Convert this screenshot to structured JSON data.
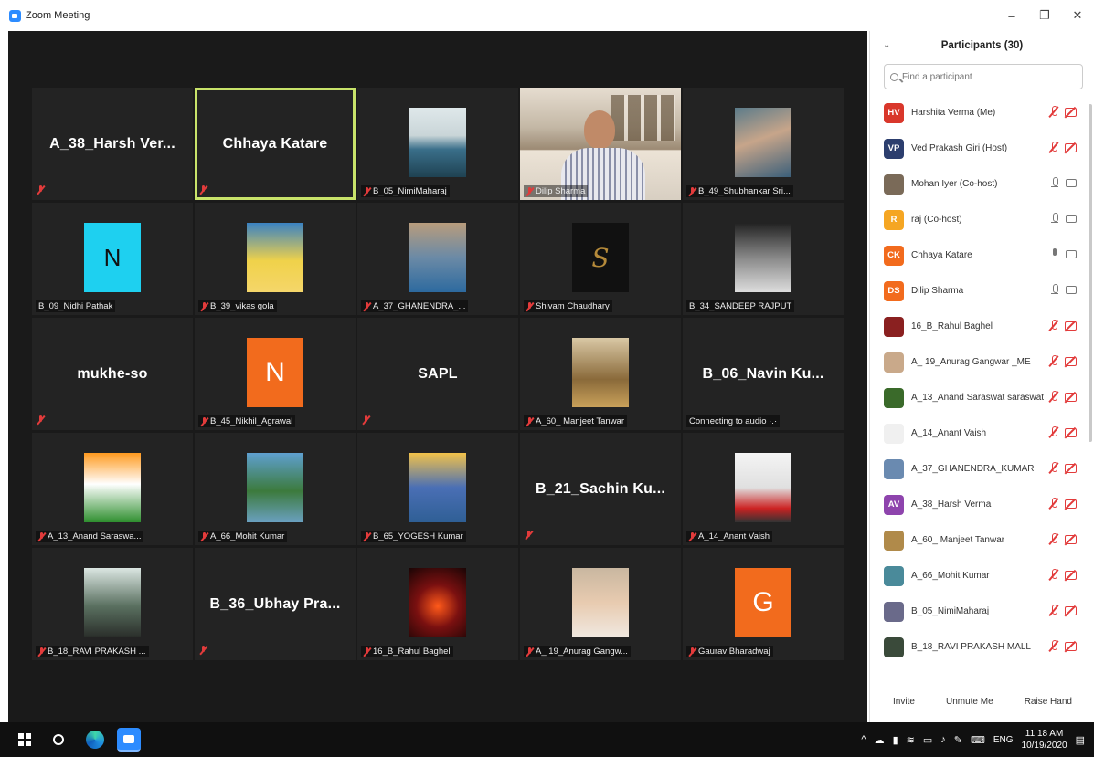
{
  "window": {
    "title": "Zoom Meeting",
    "minimize": "–",
    "restore": "❐",
    "close": "✕"
  },
  "tiles": [
    {
      "type": "text",
      "name": "A_38_Harsh Ver...",
      "label": ""
    },
    {
      "type": "text",
      "name": "Chhaya Katare",
      "label": "",
      "active": true
    },
    {
      "type": "photo",
      "photo": "ph1",
      "label": "B_05_NimiMaharaj"
    },
    {
      "type": "video",
      "label": "Dilip Sharma"
    },
    {
      "type": "photo",
      "photo": "ph2",
      "label": "B_49_Shubhankar Sri..."
    },
    {
      "type": "letter",
      "letter": "N",
      "color": "av-cyan",
      "label": "B_09_Nidhi Pathak",
      "nomute": true
    },
    {
      "type": "photo",
      "photo": "ph3",
      "label": "B_39_vikas gola"
    },
    {
      "type": "photo",
      "photo": "ph4",
      "label": "A_37_GHANENDRA_..."
    },
    {
      "type": "glyph",
      "glyph": "S",
      "label": "Shivam Chaudhary"
    },
    {
      "type": "photo",
      "photo": "ph6",
      "label": "B_34_SANDEEP RAJPUT",
      "nomute": true
    },
    {
      "type": "text",
      "name": "mukhe-so",
      "label": ""
    },
    {
      "type": "letter",
      "letter": "N",
      "color": "av-orange",
      "label": "B_45_Nikhil_Agrawal"
    },
    {
      "type": "text",
      "name": "SAPL",
      "label": ""
    },
    {
      "type": "photo",
      "photo": "ph7",
      "label": "A_60_ Manjeet Tanwar"
    },
    {
      "type": "text",
      "name": "B_06_Navin Ku...",
      "label": "Connecting to audio ·.·",
      "nomute": true
    },
    {
      "type": "photo",
      "photo": "ph8",
      "label": "A_13_Anand Saraswa..."
    },
    {
      "type": "photo",
      "photo": "ph9",
      "label": "A_66_Mohit Kumar"
    },
    {
      "type": "photo",
      "photo": "ph10",
      "label": "B_65_YOGESH Kumar"
    },
    {
      "type": "text",
      "name": "B_21_Sachin Ku...",
      "label": ""
    },
    {
      "type": "photo",
      "photo": "ph11",
      "label": "A_14_Anant Vaish"
    },
    {
      "type": "photo",
      "photo": "ph12",
      "label": "B_18_RAVI PRAKASH ..."
    },
    {
      "type": "text",
      "name": "B_36_Ubhay Pra...",
      "label": ""
    },
    {
      "type": "photo",
      "photo": "ph13",
      "label": "16_B_Rahul Baghel"
    },
    {
      "type": "photo",
      "photo": "ph14",
      "label": "A_ 19_Anurag Gangw..."
    },
    {
      "type": "letter",
      "letter": "G",
      "color": "av-orange",
      "label": "Gaurav Bharadwaj"
    }
  ],
  "participants": {
    "title": "Participants (30)",
    "search_placeholder": "Find a participant",
    "list": [
      {
        "initials": "HV",
        "color": "#d9372b",
        "name": "Harshita Verma (Me)",
        "mic": "muted",
        "cam": "off"
      },
      {
        "initials": "VP",
        "color": "#2c3e6e",
        "name": "Ved Prakash Giri (Host)",
        "mic": "muted",
        "cam": "off"
      },
      {
        "initials": "",
        "color": "#7a6a58",
        "name": "Mohan Iyer (Co-host)",
        "mic": "on",
        "cam": "on"
      },
      {
        "initials": "R",
        "color": "#f5a623",
        "name": "raj (Co-host)",
        "mic": "on",
        "cam": "on"
      },
      {
        "initials": "CK",
        "color": "#f26b1d",
        "name": "Chhaya Katare",
        "mic": "talking",
        "cam": "on"
      },
      {
        "initials": "DS",
        "color": "#f26b1d",
        "name": "Dilip Sharma",
        "mic": "on",
        "cam": "on"
      },
      {
        "initials": "",
        "color": "#8a2020",
        "name": "16_B_Rahul Baghel",
        "mic": "muted",
        "cam": "off"
      },
      {
        "initials": "",
        "color": "#c9a98a",
        "name": "A_ 19_Anurag Gangwar _ME",
        "mic": "muted",
        "cam": "off"
      },
      {
        "initials": "",
        "color": "#3a6a2a",
        "name": "A_13_Anand Saraswat saraswat",
        "mic": "muted",
        "cam": "off"
      },
      {
        "initials": "",
        "color": "#f0f0f0",
        "name": "A_14_Anant Vaish",
        "mic": "muted",
        "cam": "off"
      },
      {
        "initials": "",
        "color": "#6a8ab0",
        "name": "A_37_GHANENDRA_KUMAR",
        "mic": "muted",
        "cam": "off"
      },
      {
        "initials": "AV",
        "color": "#8e44ad",
        "name": "A_38_Harsh Verma",
        "mic": "muted",
        "cam": "off"
      },
      {
        "initials": "",
        "color": "#b08a4a",
        "name": "A_60_ Manjeet Tanwar",
        "mic": "muted",
        "cam": "off"
      },
      {
        "initials": "",
        "color": "#4a8a9a",
        "name": "A_66_Mohit Kumar",
        "mic": "muted",
        "cam": "off"
      },
      {
        "initials": "",
        "color": "#6a6a8a",
        "name": "B_05_NimiMaharaj",
        "mic": "muted",
        "cam": "off"
      },
      {
        "initials": "",
        "color": "#3a4a3a",
        "name": "B_18_RAVI PRAKASH MALL",
        "mic": "muted",
        "cam": "off"
      }
    ],
    "footer": {
      "invite": "Invite",
      "unmute": "Unmute Me",
      "raise": "Raise Hand"
    }
  },
  "taskbar": {
    "lang": "ENG",
    "time": "11:18 AM",
    "date": "10/19/2020"
  }
}
